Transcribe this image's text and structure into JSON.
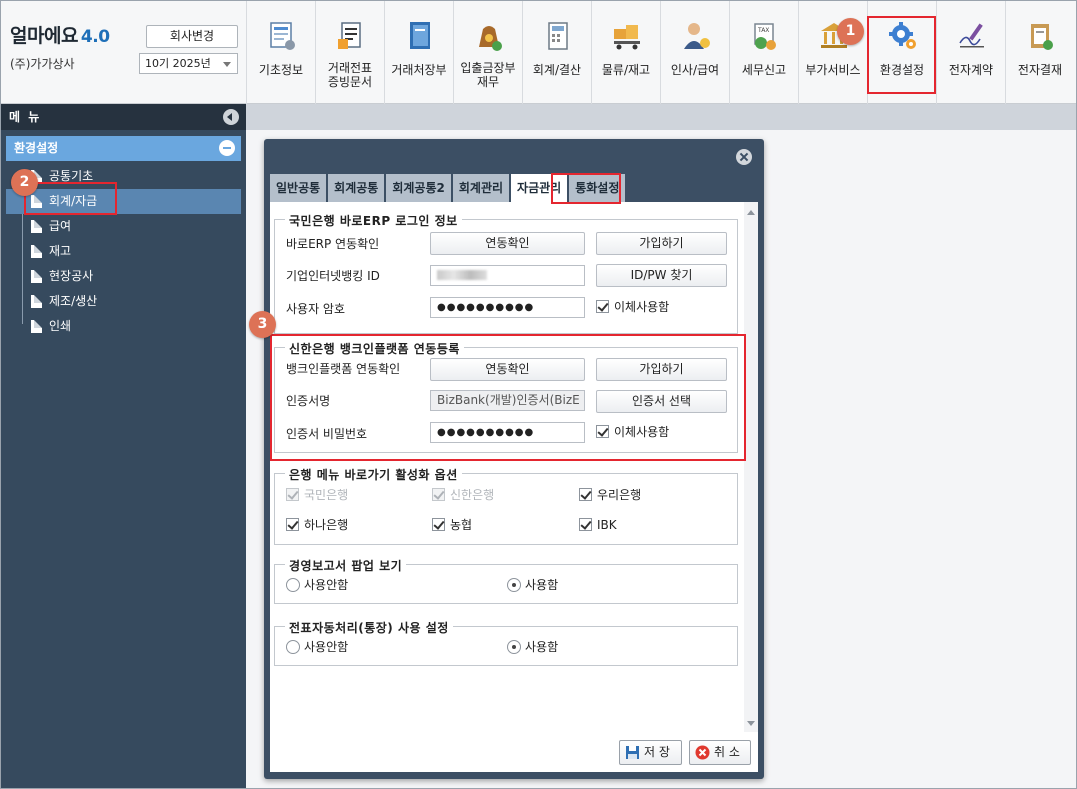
{
  "app": {
    "name": "얼마에요",
    "version": "4.0",
    "company": "(주)가가상사",
    "change_company": "회사변경",
    "period": "10기 2025년"
  },
  "toolbar": [
    {
      "label": "기초정보",
      "icon": "basic-info-icon"
    },
    {
      "label": "거래전표\n증빙문서",
      "icon": "voucher-icon"
    },
    {
      "label": "거래처장부",
      "icon": "ledger-book-icon"
    },
    {
      "label": "입출금장부\n재무",
      "icon": "money-bag-icon"
    },
    {
      "label": "회계/결산",
      "icon": "calculator-icon"
    },
    {
      "label": "물류/재고",
      "icon": "boxes-cart-icon"
    },
    {
      "label": "인사/급여",
      "icon": "person-coins-icon"
    },
    {
      "label": "세무신고",
      "icon": "tax-icon"
    },
    {
      "label": "부가서비스",
      "icon": "bank-building-icon"
    },
    {
      "label": "환경설정",
      "icon": "gear-icon"
    },
    {
      "label": "전자계약",
      "icon": "pen-sign-icon"
    },
    {
      "label": "전자결재",
      "icon": "approval-icon"
    }
  ],
  "badges": {
    "one": "1",
    "two": "2",
    "three": "3"
  },
  "sidebar": {
    "header": "메 뉴",
    "section": "환경설정",
    "items": [
      "공통기초",
      "회계/자금",
      "급여",
      "재고",
      "현장공사",
      "제조/생산",
      "인쇄"
    ]
  },
  "dialog": {
    "tabs": [
      "일반공통",
      "회계공통",
      "회계공통2",
      "회계관리",
      "자금관리",
      "통화설정"
    ],
    "kb_group": {
      "title": "국민은행 바로ERP 로그인 정보",
      "row1_label": "바로ERP 연동확인",
      "row1_btn1": "연동확인",
      "row1_btn2": "가입하기",
      "row2_label": "기업인터넷뱅킹 ID",
      "row2_btn": "ID/PW 찾기",
      "row3_label": "사용자 암호",
      "row3_value": "●●●●●●●●●●",
      "row3_check": "이체사용함"
    },
    "shinhan_group": {
      "title": "신한은행 뱅크인플랫폼 연동등록",
      "row1_label": "뱅크인플랫폼 연동확인",
      "row1_btn1": "연동확인",
      "row1_btn2": "가입하기",
      "row2_label": "인증서명",
      "row2_value": "BizBank(개발)인증서(BizE",
      "row2_btn": "인증서 선택",
      "row3_label": "인증서 비밀번호",
      "row3_value": "●●●●●●●●●●",
      "row3_check": "이체사용함"
    },
    "bank_group": {
      "title": "은행 메뉴 바로가기 활성화 옵션",
      "banks": [
        "국민은행",
        "신한은행",
        "우리은행",
        "하나은행",
        "농협",
        "IBK"
      ]
    },
    "report_group": {
      "title": "경영보고서 팝업 보기",
      "off": "사용안함",
      "on": "사용함"
    },
    "auto_group": {
      "title": "전표자동처리(통장) 사용 설정",
      "off": "사용안함",
      "on": "사용함"
    },
    "save": "저 장",
    "cancel": "취 소"
  },
  "colors": {
    "highlight": "#e4262f",
    "badge": "#dd7256",
    "sidebar": "#364a5e",
    "section": "#6aa7df"
  }
}
